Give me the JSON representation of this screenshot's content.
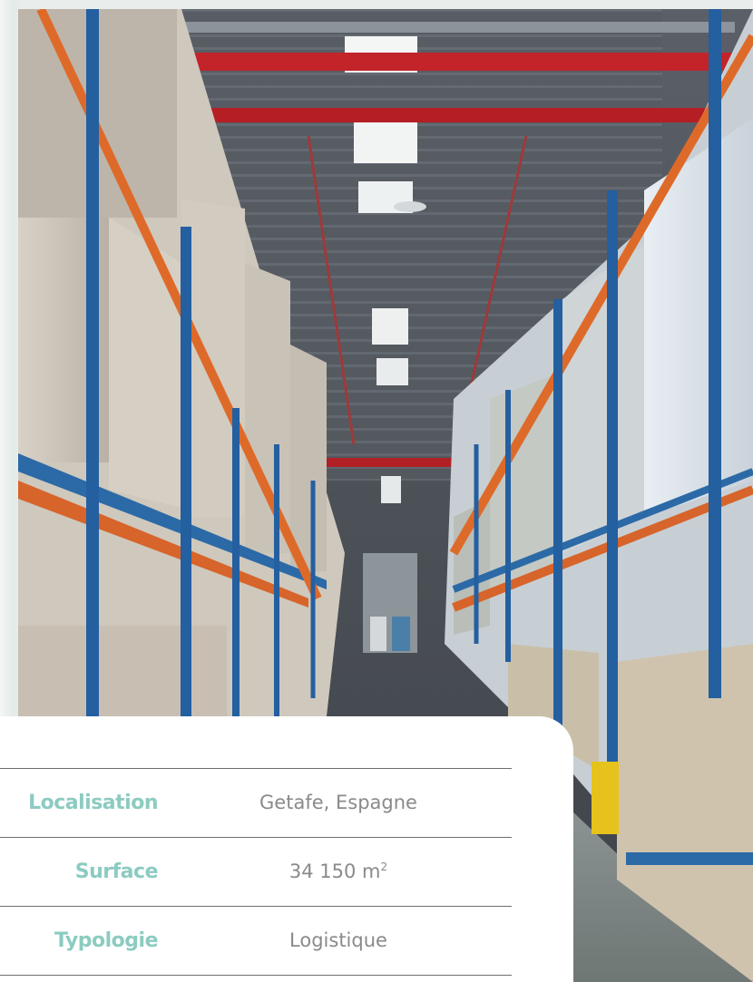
{
  "photo": {
    "subject": "warehouse-aisle-with-pallet-racks"
  },
  "details": {
    "rows": [
      {
        "label": "Localisation",
        "value": "Getafe, Espagne"
      },
      {
        "label": "Surface",
        "value": "34 150 m",
        "sup": "2"
      },
      {
        "label": "Typologie",
        "value": "Logistique"
      }
    ]
  },
  "colors": {
    "label": "#8ccbc1",
    "value": "#8a8a8a",
    "rule": "#6e6e6e",
    "card": "#ffffff"
  }
}
